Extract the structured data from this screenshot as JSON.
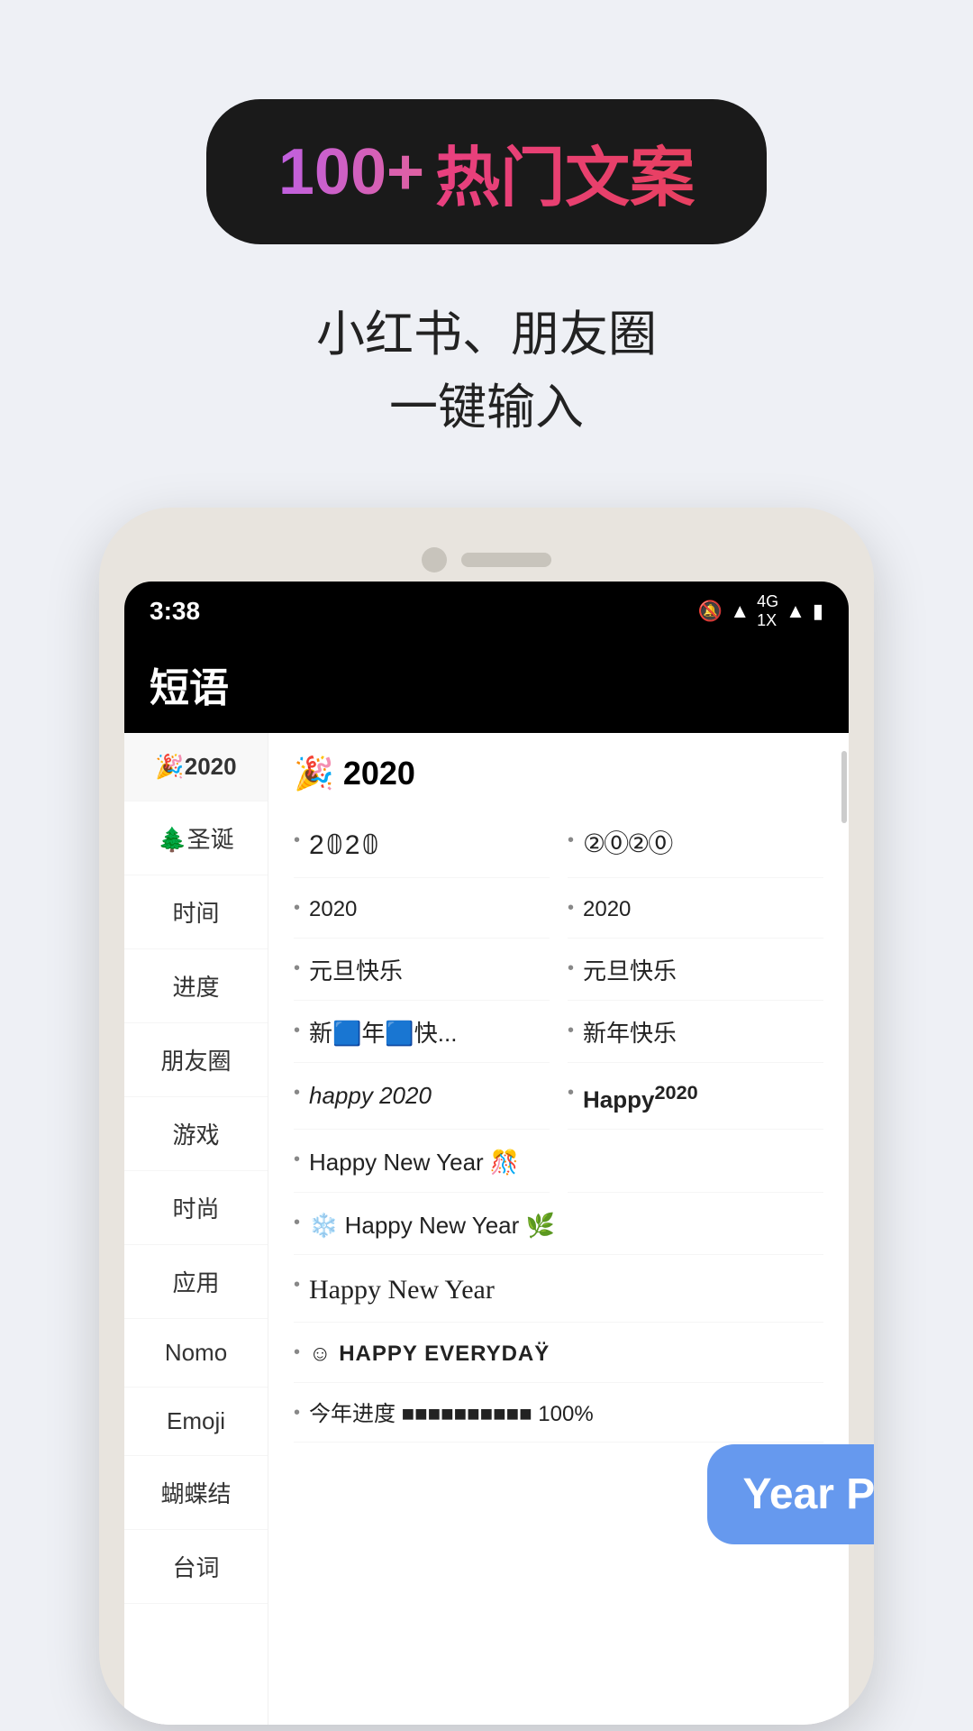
{
  "top": {
    "badge": {
      "number": "100+",
      "label": "热门文案"
    },
    "subtitle_line1": "小红书、朋友圈",
    "subtitle_line2": "一键输入"
  },
  "phone": {
    "status": {
      "time": "3:38",
      "icons": "🔕 📶 4G 1X 📶 🔋"
    },
    "header_title": "短语",
    "sidebar_items": [
      {
        "label": "🎉2020",
        "active": true
      },
      {
        "label": "🌲圣诞",
        "active": false
      },
      {
        "label": "时间",
        "active": false
      },
      {
        "label": "进度",
        "active": false
      },
      {
        "label": "朋友圈",
        "active": false
      },
      {
        "label": "游戏",
        "active": false
      },
      {
        "label": "时尚",
        "active": false
      },
      {
        "label": "应用",
        "active": false
      },
      {
        "label": "Nomo",
        "active": false
      },
      {
        "label": "Emoji",
        "active": false
      },
      {
        "label": "蝴蝶结",
        "active": false
      },
      {
        "label": "台词",
        "active": false
      }
    ],
    "section_title_emoji": "🎉",
    "section_title_text": "2020",
    "content_items": [
      {
        "col": 1,
        "text": "2020",
        "style": "normal"
      },
      {
        "col": 2,
        "text": "②⓪②⓪",
        "style": "circled"
      },
      {
        "col": 1,
        "text": "2020",
        "style": "small"
      },
      {
        "col": 2,
        "text": "2020",
        "style": "small"
      },
      {
        "col": 1,
        "text": "元旦快乐",
        "style": "normal"
      },
      {
        "col": 2,
        "text": "元旦快乐",
        "style": "normal"
      },
      {
        "col": 1,
        "text": "新🟦年🟦快...",
        "style": "normal"
      },
      {
        "col": 2,
        "text": "新年快乐",
        "style": "normal"
      },
      {
        "col": 1,
        "text": "happy 2020",
        "style": "italic"
      },
      {
        "col": 2,
        "text": "Happy²⁰²⁰",
        "style": "bold"
      },
      {
        "col": 1,
        "text": "Happy New Year 🎊",
        "style": "normal",
        "full": false
      },
      {
        "col": 2,
        "text": "",
        "style": "normal"
      },
      {
        "col": 1,
        "text": "❄️ Happy New Year 🌿",
        "style": "normal",
        "full": true
      },
      {
        "col": 1,
        "text": "Happy New Year",
        "style": "script",
        "full": true
      },
      {
        "col": 1,
        "text": "☺ HAPPY EVERYDAŸ",
        "style": "caps",
        "full": true
      },
      {
        "col": 1,
        "text": "今年进度 ■■■■■■■■■■ 100%",
        "style": "normal",
        "full": true
      }
    ],
    "bubble_text": "Year Pr"
  }
}
